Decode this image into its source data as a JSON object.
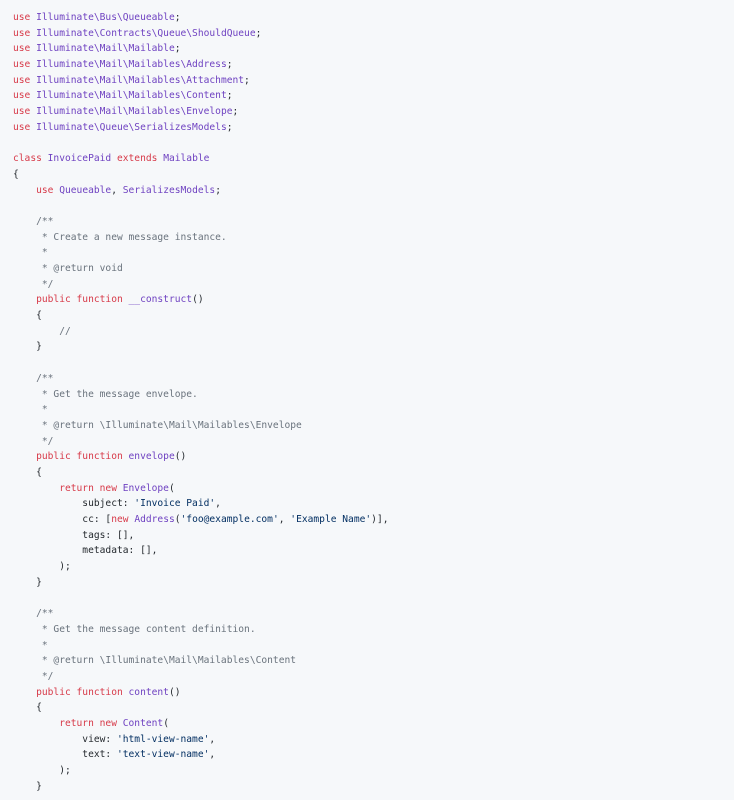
{
  "code": {
    "lines": [
      [
        {
          "t": "use ",
          "c": "kw"
        },
        {
          "t": "Illuminate\\Bus\\Queueable",
          "c": "cls"
        },
        {
          "t": ";",
          "c": "plain"
        }
      ],
      [
        {
          "t": "use ",
          "c": "kw"
        },
        {
          "t": "Illuminate\\Contracts\\Queue\\ShouldQueue",
          "c": "cls"
        },
        {
          "t": ";",
          "c": "plain"
        }
      ],
      [
        {
          "t": "use ",
          "c": "kw"
        },
        {
          "t": "Illuminate\\Mail\\Mailable",
          "c": "cls"
        },
        {
          "t": ";",
          "c": "plain"
        }
      ],
      [
        {
          "t": "use ",
          "c": "kw"
        },
        {
          "t": "Illuminate\\Mail\\Mailables\\Address",
          "c": "cls"
        },
        {
          "t": ";",
          "c": "plain"
        }
      ],
      [
        {
          "t": "use ",
          "c": "kw"
        },
        {
          "t": "Illuminate\\Mail\\Mailables\\Attachment",
          "c": "cls"
        },
        {
          "t": ";",
          "c": "plain"
        }
      ],
      [
        {
          "t": "use ",
          "c": "kw"
        },
        {
          "t": "Illuminate\\Mail\\Mailables\\Content",
          "c": "cls"
        },
        {
          "t": ";",
          "c": "plain"
        }
      ],
      [
        {
          "t": "use ",
          "c": "kw"
        },
        {
          "t": "Illuminate\\Mail\\Mailables\\Envelope",
          "c": "cls"
        },
        {
          "t": ";",
          "c": "plain"
        }
      ],
      [
        {
          "t": "use ",
          "c": "kw"
        },
        {
          "t": "Illuminate\\Queue\\SerializesModels",
          "c": "cls"
        },
        {
          "t": ";",
          "c": "plain"
        }
      ],
      [],
      [
        {
          "t": "class ",
          "c": "kw"
        },
        {
          "t": "InvoicePaid ",
          "c": "cls"
        },
        {
          "t": "extends ",
          "c": "kw"
        },
        {
          "t": "Mailable",
          "c": "cls"
        }
      ],
      [
        {
          "t": "{",
          "c": "plain"
        }
      ],
      [
        {
          "t": "    use ",
          "c": "kw"
        },
        {
          "t": "Queueable",
          "c": "cls"
        },
        {
          "t": ", ",
          "c": "plain"
        },
        {
          "t": "SerializesModels",
          "c": "cls"
        },
        {
          "t": ";",
          "c": "plain"
        }
      ],
      [],
      [
        {
          "t": "    /**",
          "c": "cmt"
        }
      ],
      [
        {
          "t": "     * Create a new message instance.",
          "c": "cmt"
        }
      ],
      [
        {
          "t": "     *",
          "c": "cmt"
        }
      ],
      [
        {
          "t": "     * @return void",
          "c": "cmt"
        }
      ],
      [
        {
          "t": "     */",
          "c": "cmt"
        }
      ],
      [
        {
          "t": "    public function ",
          "c": "kw"
        },
        {
          "t": "__construct",
          "c": "fn"
        },
        {
          "t": "()",
          "c": "plain"
        }
      ],
      [
        {
          "t": "    {",
          "c": "plain"
        }
      ],
      [
        {
          "t": "        //",
          "c": "cmt"
        }
      ],
      [
        {
          "t": "    }",
          "c": "plain"
        }
      ],
      [],
      [
        {
          "t": "    /**",
          "c": "cmt"
        }
      ],
      [
        {
          "t": "     * Get the message envelope.",
          "c": "cmt"
        }
      ],
      [
        {
          "t": "     *",
          "c": "cmt"
        }
      ],
      [
        {
          "t": "     * @return \\Illuminate\\Mail\\Mailables\\Envelope",
          "c": "cmt"
        }
      ],
      [
        {
          "t": "     */",
          "c": "cmt"
        }
      ],
      [
        {
          "t": "    public function ",
          "c": "kw"
        },
        {
          "t": "envelope",
          "c": "fn"
        },
        {
          "t": "()",
          "c": "plain"
        }
      ],
      [
        {
          "t": "    {",
          "c": "plain"
        }
      ],
      [
        {
          "t": "        return new ",
          "c": "kw"
        },
        {
          "t": "Envelope",
          "c": "cls"
        },
        {
          "t": "(",
          "c": "plain"
        }
      ],
      [
        {
          "t": "            subject: ",
          "c": "plain"
        },
        {
          "t": "'Invoice Paid'",
          "c": "str"
        },
        {
          "t": ",",
          "c": "plain"
        }
      ],
      [
        {
          "t": "            cc: [",
          "c": "plain"
        },
        {
          "t": "new ",
          "c": "kw"
        },
        {
          "t": "Address",
          "c": "cls"
        },
        {
          "t": "(",
          "c": "plain"
        },
        {
          "t": "'foo@example.com'",
          "c": "str"
        },
        {
          "t": ", ",
          "c": "plain"
        },
        {
          "t": "'Example Name'",
          "c": "str"
        },
        {
          "t": ")],",
          "c": "plain"
        }
      ],
      [
        {
          "t": "            tags: [],",
          "c": "plain"
        }
      ],
      [
        {
          "t": "            metadata: [],",
          "c": "plain"
        }
      ],
      [
        {
          "t": "        );",
          "c": "plain"
        }
      ],
      [
        {
          "t": "    }",
          "c": "plain"
        }
      ],
      [],
      [
        {
          "t": "    /**",
          "c": "cmt"
        }
      ],
      [
        {
          "t": "     * Get the message content definition.",
          "c": "cmt"
        }
      ],
      [
        {
          "t": "     *",
          "c": "cmt"
        }
      ],
      [
        {
          "t": "     * @return \\Illuminate\\Mail\\Mailables\\Content",
          "c": "cmt"
        }
      ],
      [
        {
          "t": "     */",
          "c": "cmt"
        }
      ],
      [
        {
          "t": "    public function ",
          "c": "kw"
        },
        {
          "t": "content",
          "c": "fn"
        },
        {
          "t": "()",
          "c": "plain"
        }
      ],
      [
        {
          "t": "    {",
          "c": "plain"
        }
      ],
      [
        {
          "t": "        return new ",
          "c": "kw"
        },
        {
          "t": "Content",
          "c": "cls"
        },
        {
          "t": "(",
          "c": "plain"
        }
      ],
      [
        {
          "t": "            view: ",
          "c": "plain"
        },
        {
          "t": "'html-view-name'",
          "c": "str"
        },
        {
          "t": ",",
          "c": "plain"
        }
      ],
      [
        {
          "t": "            text: ",
          "c": "plain"
        },
        {
          "t": "'text-view-name'",
          "c": "str"
        },
        {
          "t": ",",
          "c": "plain"
        }
      ],
      [
        {
          "t": "        );",
          "c": "plain"
        }
      ],
      [
        {
          "t": "    }",
          "c": "plain"
        }
      ]
    ]
  }
}
